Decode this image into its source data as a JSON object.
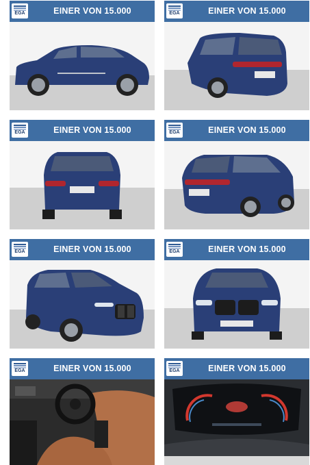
{
  "banner": {
    "logo_text": "EGA",
    "title": "EINER VON 15.000"
  },
  "tiles": [
    {
      "icon": "car-side-view-photo"
    },
    {
      "icon": "car-rear-three-quarter-photo"
    },
    {
      "icon": "car-rear-view-photo"
    },
    {
      "icon": "car-rear-three-quarter-right-photo"
    },
    {
      "icon": "car-front-three-quarter-photo"
    },
    {
      "icon": "car-front-view-photo"
    },
    {
      "icon": "car-interior-cockpit-photo"
    },
    {
      "icon": "instrument-cluster-photo"
    }
  ],
  "colors": {
    "banner": "#3f6ea3",
    "car_body": "#2a3f77",
    "floor": "#cfcfcf",
    "leather": "#b27048"
  }
}
